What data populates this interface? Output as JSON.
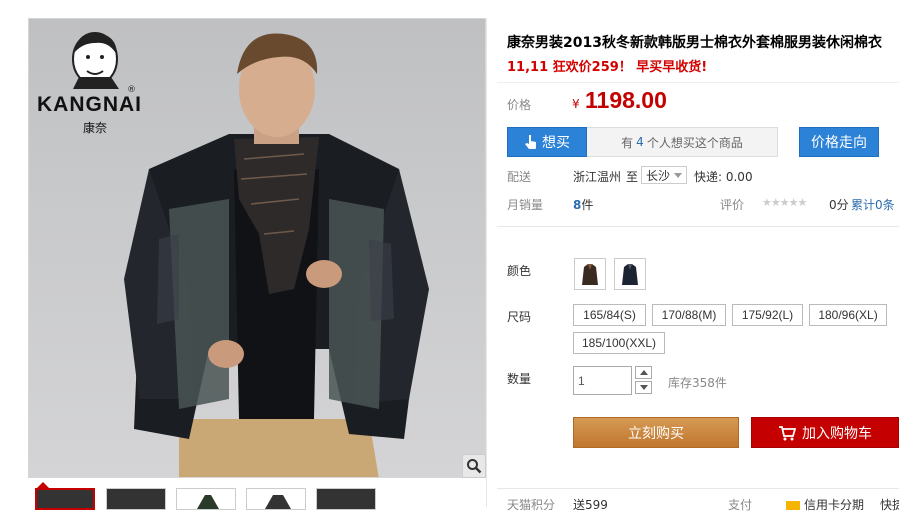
{
  "product": {
    "title": "康奈男装2013秋冬新款韩版男士棉衣外套棉服男装休闲棉衣",
    "promo": "11,11 狂欢价259！ 早买早收货!"
  },
  "brand": {
    "logo_name": "KANGNAI",
    "logo_cn": "康奈",
    "registered": "®"
  },
  "price": {
    "label": "价格",
    "currency": "¥",
    "value": "1198.00"
  },
  "want": {
    "button_label": "想买",
    "info_prefix": "有",
    "count": "4",
    "info_suffix": "个人想买这个商品",
    "trend_label": "价格走向"
  },
  "shipping": {
    "label": "配送",
    "from": "浙江温州",
    "to_word": "至",
    "destination": "长沙",
    "express": "快递: 0.00"
  },
  "sales": {
    "label": "月销量",
    "count": "8",
    "unit": "件",
    "rating_label": "评价",
    "stars": "★★★★★",
    "score": "0分",
    "cumulative": "累计0条"
  },
  "colors": {
    "label": "颜色",
    "options": [
      "brown-jacket",
      "navy-jacket"
    ]
  },
  "sizes": {
    "label": "尺码",
    "options": [
      "165/84(S)",
      "170/88(M)",
      "175/92(L)",
      "180/96(XL)",
      "185/100(XXL)"
    ]
  },
  "quantity": {
    "label": "数量",
    "value": "1",
    "stock": "库存358件"
  },
  "actions": {
    "buy_now": "立刻购买",
    "add_cart": "加入购物车"
  },
  "bottom": {
    "points_label": "天猫积分",
    "points_value": "送599",
    "pay_label": "支付",
    "pay_option": "信用卡分期",
    "extra": "快捷"
  },
  "colors_theme": {
    "accent_red": "#c40000",
    "blue": "#2b82d6",
    "orange": "#c8853e"
  }
}
